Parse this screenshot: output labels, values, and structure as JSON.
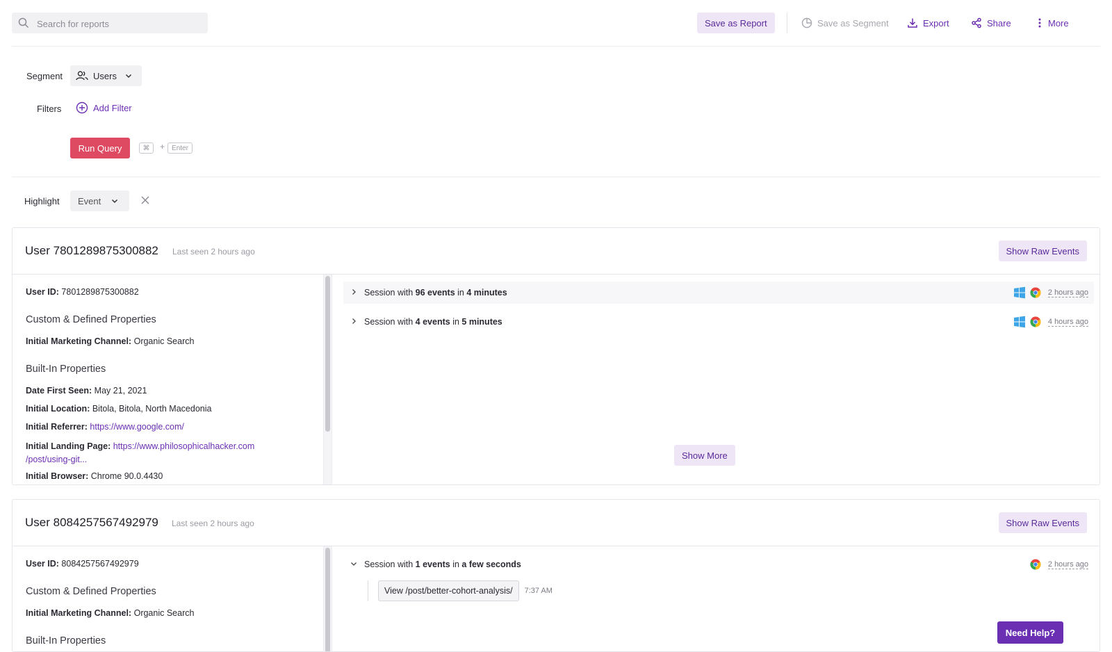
{
  "topbar": {
    "search_placeholder": "Search for reports",
    "save_report_label": "Save as Report",
    "save_segment_label": "Save as Segment",
    "export_label": "Export",
    "share_label": "Share",
    "more_label": "More"
  },
  "query": {
    "segment_label": "Segment",
    "segment_value": "Users",
    "filters_label": "Filters",
    "add_filter_label": "Add Filter",
    "run_label": "Run Query",
    "shortcut_key1": "⌘",
    "shortcut_plus": "+",
    "shortcut_key2": "Enter"
  },
  "highlight": {
    "label": "Highlight",
    "value": "Event"
  },
  "users": [
    {
      "title": "User 7801289875300882",
      "last_seen": "Last seen 2 hours ago",
      "raw_label": "Show Raw Events",
      "user_id_key": "User ID:",
      "user_id": "7801289875300882",
      "custom_heading": "Custom & Defined Properties",
      "channel_key": "Initial Marketing Channel:",
      "channel": "Organic Search",
      "builtin_heading": "Built-In Properties",
      "date_key": "Date First Seen:",
      "date": "May 21, 2021",
      "location_key": "Initial Location:",
      "location": "Bitola, Bitola, North Macedonia",
      "referrer_key": "Initial Referrer:",
      "referrer": "https://www.google.com/",
      "landing_key": "Initial Landing Page:",
      "landing_1": "https://www.philosophicalhacker.com",
      "landing_2": "/post/using-git...",
      "browser_key": "Initial Browser:",
      "browser": "Chrome 90.0.4430",
      "sessions": [
        {
          "prefix": "Session with",
          "events": "96 events",
          "mid": "in",
          "duration": "4 minutes",
          "ago": "2 hours ago",
          "os": "windows-icon",
          "browser": "chrome-icon"
        },
        {
          "prefix": "Session with",
          "events": "4 events",
          "mid": "in",
          "duration": "5 minutes",
          "ago": "4 hours ago",
          "os": "windows-icon",
          "browser": "chrome-icon"
        }
      ],
      "show_more_label": "Show More"
    },
    {
      "title": "User 8084257567492979",
      "last_seen": "Last seen 2 hours ago",
      "raw_label": "Show Raw Events",
      "user_id_key": "User ID:",
      "user_id": "8084257567492979",
      "custom_heading": "Custom & Defined Properties",
      "channel_key": "Initial Marketing Channel:",
      "channel": "Organic Search",
      "builtin_heading": "Built-In Properties",
      "sessions": [
        {
          "prefix": "Session with",
          "events": "1 events",
          "mid": "in",
          "duration": "a few seconds",
          "ago": "2 hours ago",
          "browser": "chrome-icon",
          "event": {
            "label": "View /post/better-cohort-analysis/",
            "time": "7:37 AM"
          }
        }
      ]
    }
  ],
  "help_label": "Need Help?",
  "colors": {
    "accent": "#6b2fb3",
    "run": "#de4a61",
    "accent_bg": "#eee6f7"
  }
}
